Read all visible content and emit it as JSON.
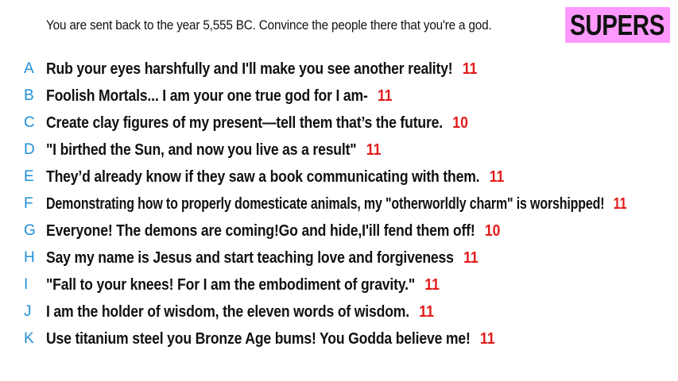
{
  "prompt": "You are sent back to the year 5,555 BC. Convince the people there that you're a god.",
  "badge": "SUPERS",
  "colors": {
    "letter": "#1f8fd6",
    "score": "#e31b1b",
    "badge_bg": "#ff99ff",
    "text": "#111111"
  },
  "answers": [
    {
      "letter": "A",
      "text": "Rub your eyes harshfully and I'll make you see another reality!",
      "score": "11"
    },
    {
      "letter": "B",
      "text": "Foolish Mortals... I am your one true god for I am-",
      "score": "11"
    },
    {
      "letter": "C",
      "text": "Create clay figures of my present—tell them that’s the future.",
      "score": "10"
    },
    {
      "letter": "D",
      "text": "\"I birthed the Sun, and now you live as a result\"",
      "score": "11"
    },
    {
      "letter": "E",
      "text": "They’d already know if they saw a book communicating with them.",
      "score": "11"
    },
    {
      "letter": "F",
      "text": "Demonstrating how to properly domesticate animals, my \"otherworldly charm\" is worshipped!",
      "score": "11"
    },
    {
      "letter": "G",
      "text": "Everyone! The demons are coming!Go and hide,I'ill fend them off!",
      "score": "10"
    },
    {
      "letter": "H",
      "text": "Say my name is Jesus and start teaching love and forgiveness",
      "score": "11"
    },
    {
      "letter": "I",
      "text": "\"Fall to your knees! For I am the embodiment of gravity.\"",
      "score": "11"
    },
    {
      "letter": "J",
      "text": "I am the holder of wisdom, the eleven words of wisdom.",
      "score": "11"
    },
    {
      "letter": "K",
      "text": "Use titanium steel you Bronze Age bums! You Godda believe me!",
      "score": "11"
    }
  ]
}
